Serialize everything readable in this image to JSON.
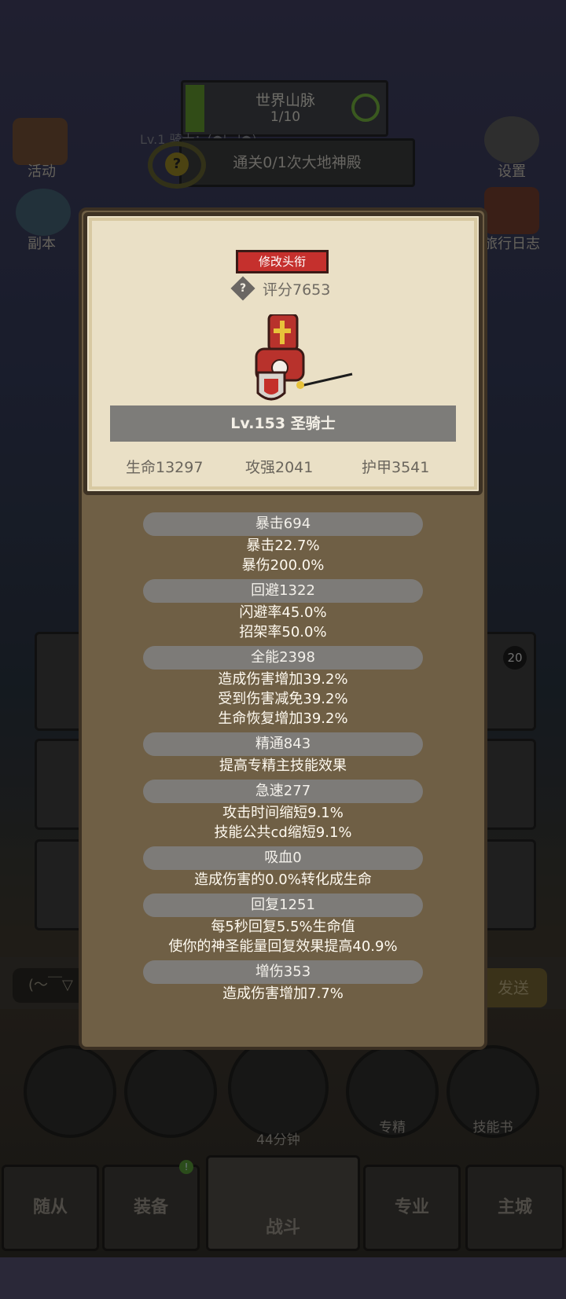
{
  "hud": {
    "world_title": "世界山脉",
    "world_count": "1/10",
    "quest_label": "Lv.1 骑士：(●'◡'●)",
    "quest_text": "通关0/1次大地神殿",
    "activity_label": "活动",
    "dungeon_label": "副本",
    "settings_label": "设置",
    "journal_label": "旅行日志"
  },
  "profile": {
    "change_title_button": "修改头衔",
    "score": "评分7653",
    "name": "Lv.153 圣骑士",
    "hp": "生命13297",
    "attack": "攻强2041",
    "armor": "护甲3541"
  },
  "stats": [
    {
      "header": "暴击694",
      "lines": [
        "暴击22.7%",
        "暴伤200.0%"
      ]
    },
    {
      "header": "回避1322",
      "lines": [
        "闪避率45.0%",
        "招架率50.0%"
      ]
    },
    {
      "header": "全能2398",
      "lines": [
        "造成伤害增加39.2%",
        "受到伤害减免39.2%",
        "生命恢复增加39.2%"
      ]
    },
    {
      "header": "精通843",
      "lines": [
        "提高专精主技能效果"
      ]
    },
    {
      "header": "急速277",
      "lines": [
        "攻击时间缩短9.1%",
        "技能公共cd缩短9.1%"
      ]
    },
    {
      "header": "吸血0",
      "lines": [
        "造成伤害的0.0%转化成生命"
      ]
    },
    {
      "header": "回复1251",
      "lines": [
        "每5秒回复5.5%生命值",
        "使你的神圣能量回复效果提高40.9%"
      ]
    },
    {
      "header": "增伤353",
      "lines": [
        "造成伤害增加7.7%"
      ]
    }
  ],
  "chat": {
    "input_text": "(～￣▽",
    "send_label": "发送"
  },
  "bottom": {
    "chest_time": "44分钟",
    "spec_label": "专精",
    "skillbook_label": "技能书",
    "badge_20": "20"
  },
  "tabs": {
    "followers": "随从",
    "equipment": "装备",
    "battle": "战斗",
    "profession": "专业",
    "main_city": "主城"
  },
  "colors": {
    "accent_red": "#c5302d",
    "pill_gray": "#7d7b78",
    "panel_brown": "#6f5f45",
    "card_bg": "#eae0c6"
  }
}
